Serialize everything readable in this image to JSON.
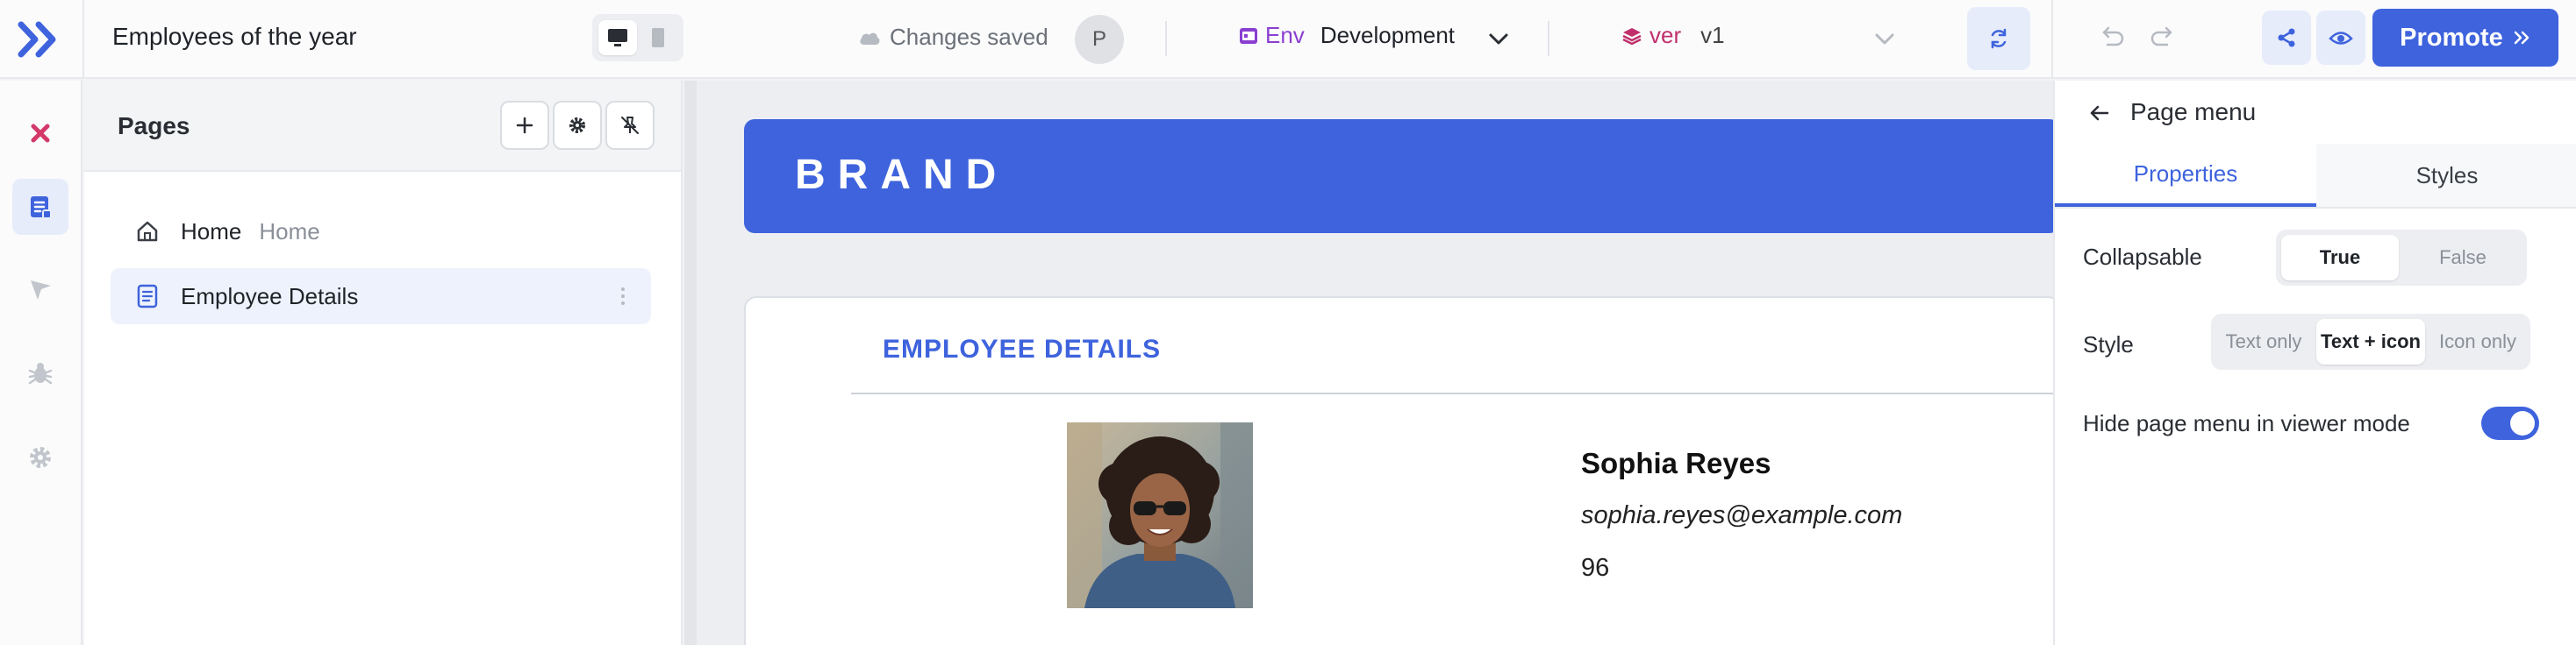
{
  "app": {
    "title": "Employees of the year",
    "status": "Changes saved",
    "user_initial": "P"
  },
  "env": {
    "label": "Env",
    "value": "Development"
  },
  "version": {
    "label": "ver",
    "value": "v1"
  },
  "toolbar": {
    "promote_label": "Promote"
  },
  "pages": {
    "title": "Pages",
    "items": [
      {
        "name": "Home",
        "alias": "Home",
        "icon": "home-icon"
      },
      {
        "name": "Employee Details",
        "alias": "",
        "icon": "file-icon"
      }
    ]
  },
  "canvas": {
    "brand": "BRAND",
    "card_title": "EMPLOYEE DETAILS",
    "employee": {
      "name": "Sophia Reyes",
      "email": "sophia.reyes@example.com",
      "score": "96"
    }
  },
  "properties": {
    "title": "Page menu",
    "tabs": [
      "Properties",
      "Styles"
    ],
    "collapsable": {
      "label": "Collapsable",
      "options": [
        "True",
        "False"
      ],
      "selected": "True"
    },
    "style": {
      "label": "Style",
      "options": [
        "Text only",
        "Text + icon",
        "Icon only"
      ],
      "selected": "Text + icon"
    },
    "hide_menu": {
      "label": "Hide page menu in viewer mode",
      "enabled": true
    }
  },
  "colors": {
    "accent": "#3e63dd",
    "env": "#8a3fd1",
    "version": "#c0306b"
  }
}
